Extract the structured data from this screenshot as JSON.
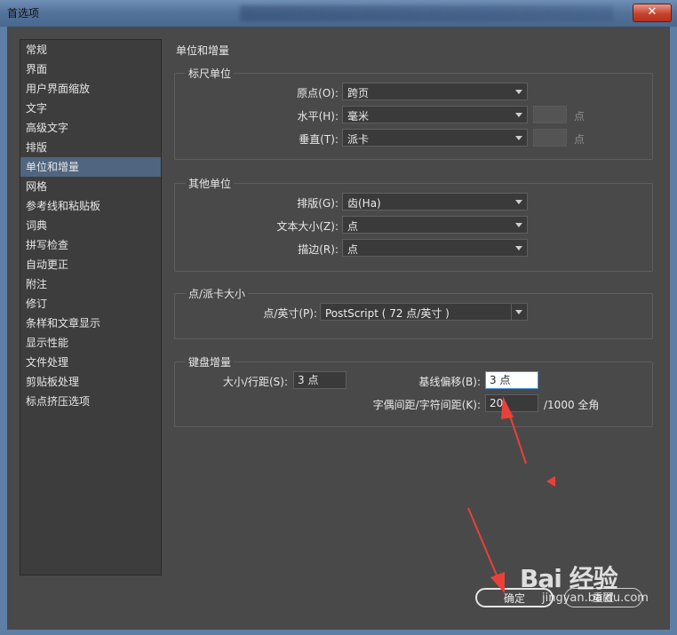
{
  "window": {
    "title": "首选项",
    "close_glyph": "✕"
  },
  "sidebar": {
    "items": [
      {
        "label": "常规"
      },
      {
        "label": "界面"
      },
      {
        "label": "用户界面缩放"
      },
      {
        "label": "文字"
      },
      {
        "label": "高级文字"
      },
      {
        "label": "排版"
      },
      {
        "label": "单位和增量",
        "selected": true
      },
      {
        "label": "网格"
      },
      {
        "label": "参考线和粘贴板"
      },
      {
        "label": "词典"
      },
      {
        "label": "拼写检查"
      },
      {
        "label": "自动更正"
      },
      {
        "label": "附注"
      },
      {
        "label": "修订"
      },
      {
        "label": "条样和文章显示"
      },
      {
        "label": "显示性能"
      },
      {
        "label": "文件处理"
      },
      {
        "label": "剪贴板处理"
      },
      {
        "label": "标点挤压选项"
      }
    ]
  },
  "main": {
    "title": "单位和增量",
    "ruler_units": {
      "title": "标尺单位",
      "origin_label": "原点(O):",
      "origin_value": "跨页",
      "horizontal_label": "水平(H):",
      "horizontal_value": "毫米",
      "horizontal_unit": "点",
      "vertical_label": "垂直(T):",
      "vertical_value": "派卡",
      "vertical_unit": "点"
    },
    "other_units": {
      "title": "其他单位",
      "composition_label": "排版(G):",
      "composition_value": "齿(Ha)",
      "text_size_label": "文本大小(Z):",
      "text_size_value": "点",
      "stroke_label": "描边(R):",
      "stroke_value": "点"
    },
    "point_pica": {
      "title": "点/派卡大小",
      "points_inch_label": "点/英寸(P):",
      "points_inch_value": "PostScript ( 72 点/英寸 )"
    },
    "keyboard_increments": {
      "title": "键盘增量",
      "size_leading_label": "大小/行距(S):",
      "size_leading_value": "3 点",
      "baseline_shift_label": "基线偏移(B):",
      "baseline_shift_value": "3 点",
      "kerning_label": "字偶间距/字符间距(K):",
      "kerning_value": "20",
      "kerning_unit": "/1000 全角"
    }
  },
  "buttons": {
    "ok": "确定",
    "reset": "重置"
  },
  "watermark": {
    "logo": "Bai 经验",
    "url": "jingyan.baidu.com"
  },
  "colors": {
    "background": "#494949",
    "sidebar_bg": "#3d3d3d",
    "sidebar_selected": "#50657f",
    "annotation_arrow": "#e8413a"
  }
}
